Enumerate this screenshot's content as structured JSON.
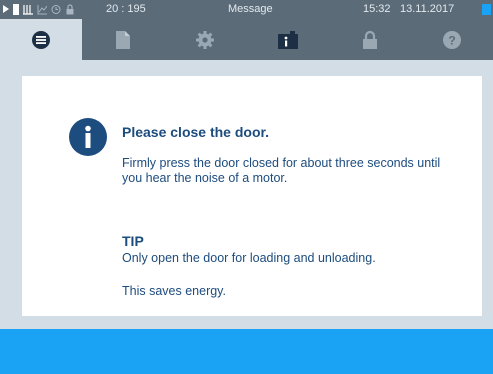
{
  "status_bar": {
    "icons": [
      "play-icon",
      "document-icon",
      "heating-icon",
      "graph-icon",
      "clock-icon",
      "lock-icon"
    ],
    "counter": "20 : 195",
    "message": "Message",
    "time": "15:32",
    "date": "13.11.2017",
    "indicator_color": "#1aa3f5"
  },
  "tabs": [
    {
      "name": "menu",
      "icon": "list-icon",
      "active": true
    },
    {
      "name": "log",
      "icon": "document-icon",
      "active": false
    },
    {
      "name": "settings",
      "icon": "gear-icon",
      "active": false
    },
    {
      "name": "info",
      "icon": "info-device-icon",
      "active": false
    },
    {
      "name": "lock",
      "icon": "lock-icon",
      "active": false
    },
    {
      "name": "help",
      "icon": "help-icon",
      "active": false
    }
  ],
  "message": {
    "icon": "info-icon",
    "title": "Please close the door.",
    "body": "Firmly press the door closed for about three seconds until you hear the noise of a motor.",
    "tip_heading": "TIP",
    "tip_text": "Only open the door for loading and unloading.",
    "tip_note": "This saves energy."
  },
  "colors": {
    "header_bg": "#5b6b78",
    "content_bg": "#d3dde6",
    "text_primary": "#1d4c7e",
    "accent": "#1aa3f5"
  }
}
